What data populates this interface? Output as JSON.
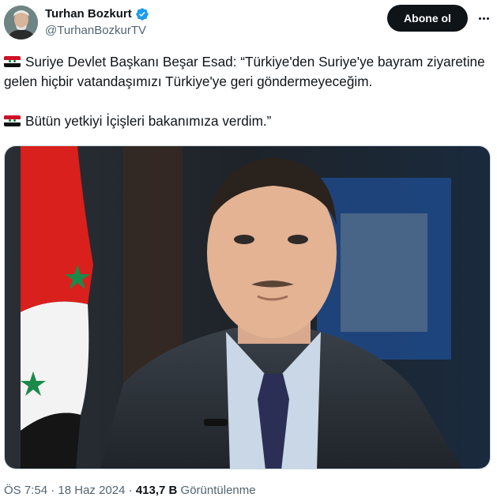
{
  "author": {
    "display_name": "Turhan Bozkurt",
    "handle": "@TurhanBozkurTV",
    "verified_icon": "verified-badge-icon",
    "verified_color": "#1d9bf0"
  },
  "actions": {
    "follow_label": "Abone ol",
    "more_icon": "more-options-icon"
  },
  "tweet": {
    "paragraph1": "Suriye Devlet Başkanı Beşar Esad: “Türkiye'den Suriye'ye bayram ziyaretine gelen hiçbir vatandaşımızı Türkiye'ye geri göndermeyeceğim.",
    "paragraph2": "Bütün yetkiyi İçişleri bakanımıza verdim.”",
    "flag_icon": "syria-flag-icon"
  },
  "meta": {
    "time": "ÖS 7:54",
    "date": "18 Haz 2024",
    "separator": "·",
    "views_count": "413,7 B",
    "views_label": "Görüntülenme"
  },
  "colors": {
    "text_primary": "#0f1419",
    "text_secondary": "#536471",
    "button_bg": "#0f1419"
  }
}
